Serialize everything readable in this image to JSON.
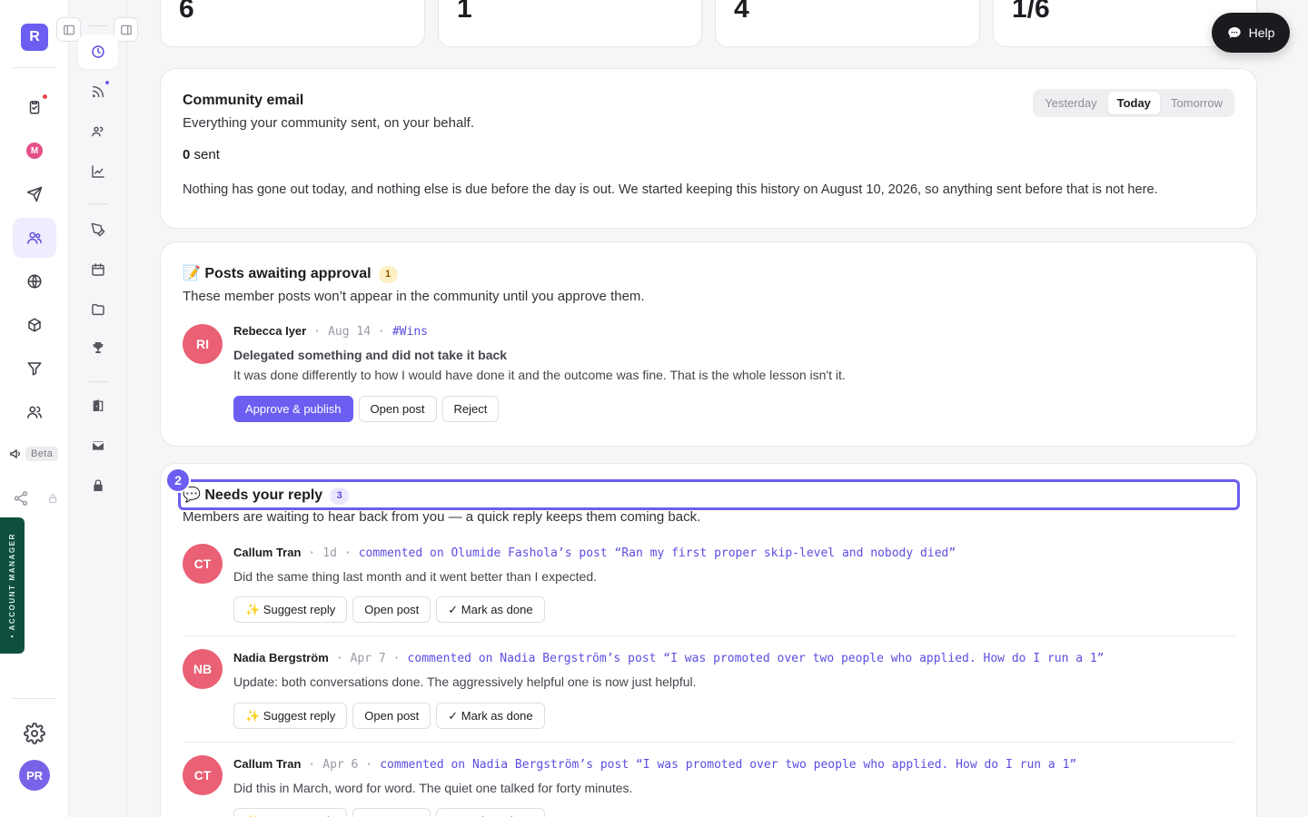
{
  "workspace": {
    "logo_letter": "R",
    "user_initials": "PR"
  },
  "rail": {
    "beta_label": "Beta",
    "account_manager_label": "• ACCOUNT MANAGER",
    "m_badge": "M"
  },
  "stats": [
    "6",
    "1",
    "4",
    "1/6"
  ],
  "community_email": {
    "title": "Community email",
    "subtitle": "Everything your community sent, on your behalf.",
    "sent_count": "0",
    "sent_label": "sent",
    "note": "Nothing has gone out today, and nothing else is due before the day is out. We started keeping this history on August 10, 2026, so anything sent before that is not here.",
    "tabs": [
      "Yesterday",
      "Today",
      "Tomorrow"
    ],
    "active_tab": "Today"
  },
  "approval": {
    "emoji": "📝",
    "title": "Posts awaiting approval",
    "count": "1",
    "subtitle": "These member posts won’t appear in the community until you approve them.",
    "post": {
      "initials": "RI",
      "author": "Rebecca Iyer",
      "date": "Aug 14",
      "channel": "#Wins",
      "title": "Delegated something and did not take it back",
      "body": "It was done differently to how I would have done it and the outcome was fine. That is the whole lesson isn't it.",
      "approve_label": "Approve & publish",
      "open_label": "Open post",
      "reject_label": "Reject"
    }
  },
  "replies": {
    "step_number": "2",
    "emoji": "💬",
    "title": "Needs your reply",
    "count": "3",
    "subtitle": "Members are waiting to hear back from you — a quick reply keeps them coming back.",
    "suggest_label": "✨ Suggest reply",
    "open_label": "Open post",
    "done_label": "✓ Mark as done",
    "items": [
      {
        "initials": "CT",
        "author": "Callum Tran",
        "time": "1d",
        "context": "commented on Olumide Fashola’s post “Ran my first proper skip-level and nobody died”",
        "body": "Did the same thing last month and it went better than I expected."
      },
      {
        "initials": "NB",
        "author": "Nadia Bergström",
        "time": "Apr 7",
        "context": "commented on Nadia Bergström’s post “I was promoted over two people who applied. How do I run a 1”",
        "body": "Update: both conversations done. The aggressively helpful one is now just helpful."
      },
      {
        "initials": "CT",
        "author": "Callum Tran",
        "time": "Apr 6",
        "context": "commented on Nadia Bergström’s post “I was promoted over two people who applied. How do I run a 1”",
        "body": "Did this in March, word for word. The quiet one talked for forty minutes."
      }
    ]
  },
  "help": {
    "label": "Help"
  }
}
